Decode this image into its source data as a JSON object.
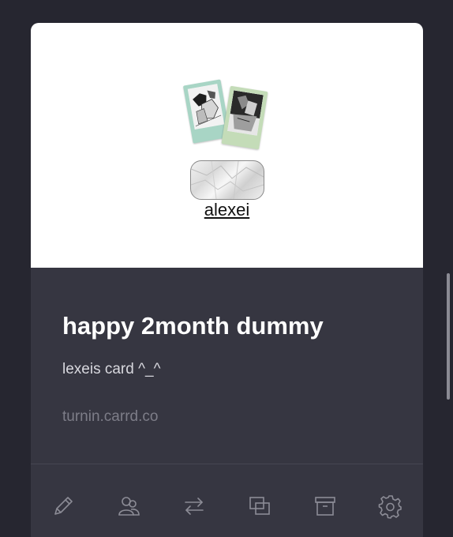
{
  "card": {
    "preview": {
      "name_link": "alexei",
      "polaroid_colors": [
        "#a8d5c5",
        "#c4dcb8"
      ]
    },
    "title": "happy 2month dummy",
    "description": "lexeis card ^_^",
    "url": "turnin.carrd.co"
  },
  "toolbar": {
    "icons": [
      "edit-pencil-icon",
      "users-icon",
      "transfer-arrows-icon",
      "duplicate-icon",
      "archive-box-icon",
      "settings-gear-icon"
    ]
  },
  "colors": {
    "background": "#262630",
    "card": "#363641",
    "preview": "#ffffff",
    "title": "#ffffff",
    "description": "#d8d8de",
    "url": "#7d7d88",
    "icon": "#8c8c96"
  }
}
